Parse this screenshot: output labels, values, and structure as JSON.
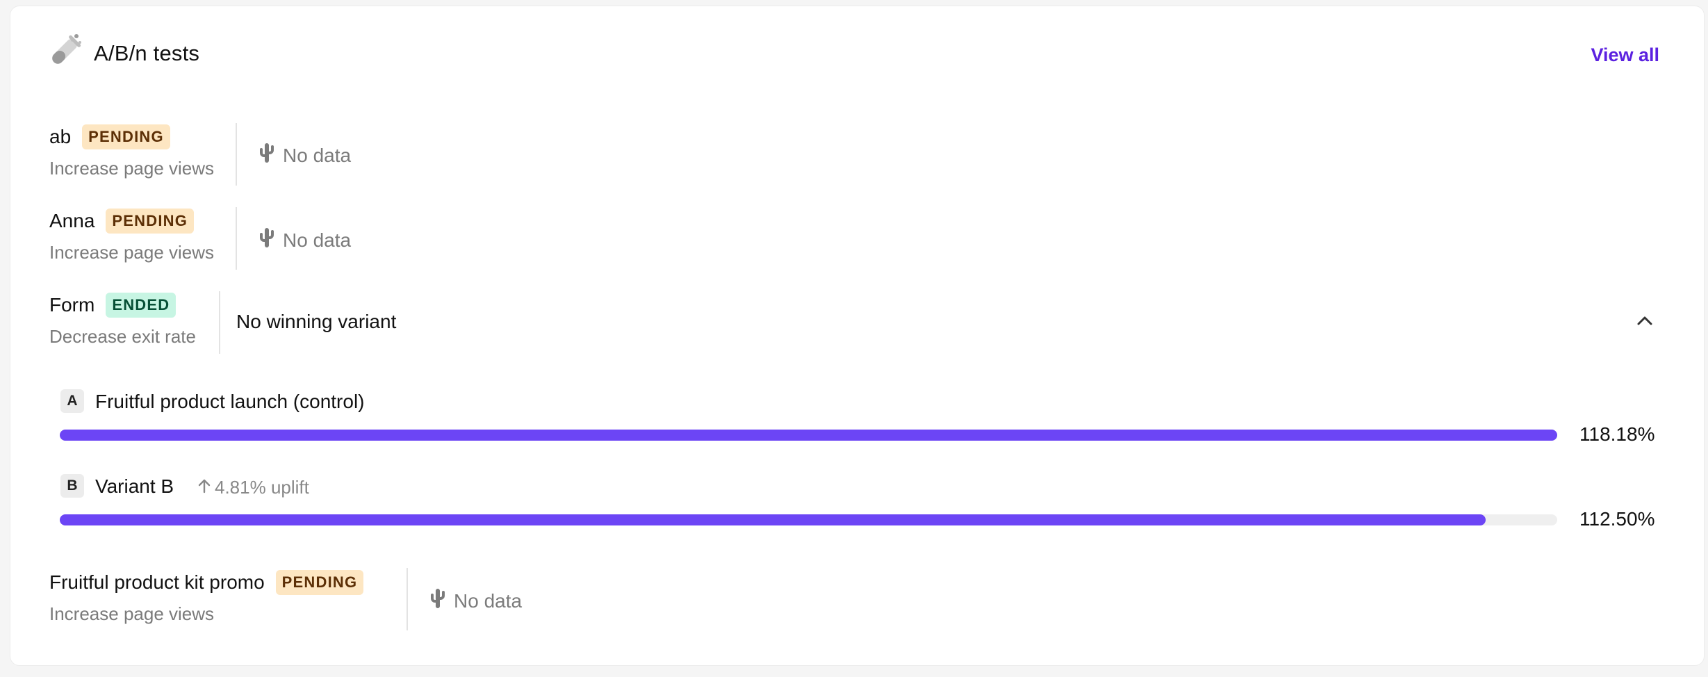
{
  "header": {
    "title": "A/B/n tests",
    "view_all": "View all",
    "icon": "test-tube-icon"
  },
  "tests": [
    {
      "name": "ab",
      "status": "PENDING",
      "goal": "Increase page views",
      "result": "No data"
    },
    {
      "name": "Anna",
      "status": "PENDING",
      "goal": "Increase page views",
      "result": "No data"
    },
    {
      "name": "Form",
      "status": "ENDED",
      "goal": "Decrease exit rate",
      "result": "No winning variant",
      "expanded": true,
      "variants": [
        {
          "letter": "A",
          "name": "Fruitful product launch (control)",
          "value_label": "118.18%",
          "fill_fraction": 1.0,
          "uplift": ""
        },
        {
          "letter": "B",
          "name": "Variant B",
          "value_label": "112.50%",
          "fill_fraction": 0.952,
          "uplift": "4.81% uplift"
        }
      ]
    },
    {
      "name": "Fruitful product kit promo",
      "status": "PENDING",
      "goal": "Increase page views",
      "result": "No data"
    }
  ],
  "colors": {
    "accent": "#5b21e0",
    "bar": "#6c45f5",
    "pending_bg": "#fde6c2",
    "ended_bg": "#c7f5e3"
  }
}
